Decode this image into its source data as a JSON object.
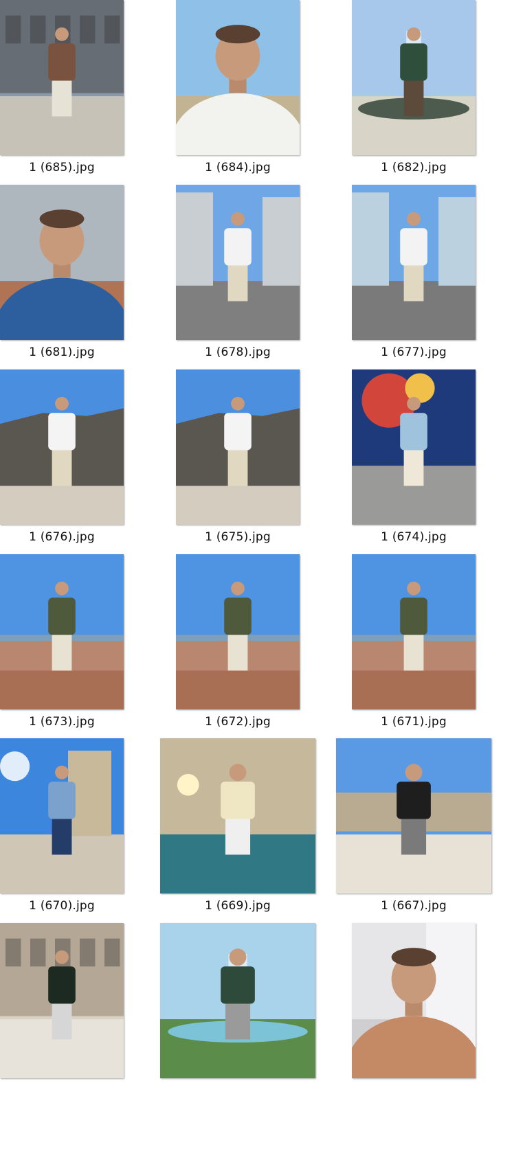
{
  "files": [
    {
      "name": "1 (685).jpg",
      "scene": "building",
      "colors": {
        "sky": "#8a97a8",
        "ground": "#c7c2b7",
        "fg": "#3b3a38",
        "shirt": "#7a5240",
        "pants": "#e7e2d6"
      }
    },
    {
      "name": "1 (684).jpg",
      "scene": "selfie",
      "colors": {
        "sky": "#8fc1e8",
        "ground": "#c2b493",
        "fg": "#b89c80",
        "shirt": "#f2f2ef",
        "pants": "#f2f2ef"
      }
    },
    {
      "name": "1 (682).jpg",
      "scene": "fountain",
      "colors": {
        "sky": "#a7c8ea",
        "ground": "#d9d4c8",
        "fg": "#4d5b4f",
        "shirt": "#2f4f3c",
        "pants": "#5c4b3a"
      }
    },
    {
      "name": "1 (681).jpg",
      "scene": "selfie",
      "colors": {
        "sky": "#aeb6be",
        "ground": "#b07454",
        "fg": "#b97b5c",
        "shirt": "#2d5f9e",
        "pants": "#2d5f9e"
      }
    },
    {
      "name": "1 (678).jpg",
      "scene": "street",
      "colors": {
        "sky": "#6fa7e6",
        "ground": "#7f7f7f",
        "fg": "#c9ced2",
        "shirt": "#f3f3f3",
        "pants": "#e1d8c2"
      }
    },
    {
      "name": "1 (677).jpg",
      "scene": "street",
      "colors": {
        "sky": "#6ea7e6",
        "ground": "#7a7a7a",
        "fg": "#bcd1e0",
        "shirt": "#f3f3f3",
        "pants": "#e1d8c2"
      }
    },
    {
      "name": "1 (676).jpg",
      "scene": "cliff",
      "colors": {
        "sky": "#4a8ee0",
        "ground": "#d4cdbf",
        "fg": "#5a5650",
        "shirt": "#f4f4f4",
        "pants": "#e1d8c2"
      }
    },
    {
      "name": "1 (675).jpg",
      "scene": "cliff",
      "colors": {
        "sky": "#4d8fdf",
        "ground": "#d4cdbf",
        "fg": "#5a5650",
        "shirt": "#f4f4f4",
        "pants": "#e1d8c2"
      }
    },
    {
      "name": "1 (674).jpg",
      "scene": "mural",
      "colors": {
        "sky": "#1e3a7a",
        "ground": "#9a9a98",
        "fg": "#d1453b",
        "shirt": "#9fc3dc",
        "pants": "#efe8d8"
      }
    },
    {
      "name": "1 (673).jpg",
      "scene": "viewpoint",
      "colors": {
        "sky": "#4f93e3",
        "ground": "#a96f55",
        "fg": "#c99f88",
        "shirt": "#4f5a3c",
        "pants": "#e8e2d2"
      }
    },
    {
      "name": "1 (672).jpg",
      "scene": "viewpoint",
      "colors": {
        "sky": "#4f93e3",
        "ground": "#a96f55",
        "fg": "#c99f88",
        "shirt": "#4f5a3c",
        "pants": "#e8e2d2"
      }
    },
    {
      "name": "1 (671).jpg",
      "scene": "viewpoint",
      "colors": {
        "sky": "#4f93e3",
        "ground": "#a96f55",
        "fg": "#c99f88",
        "shirt": "#4f5a3c",
        "pants": "#e8e2d2"
      }
    },
    {
      "name": "1 (670).jpg",
      "scene": "tower",
      "colors": {
        "sky": "#3d86dd",
        "ground": "#cfc6b5",
        "fg": "#c8b99a",
        "shirt": "#7aa2cc",
        "pants": "#233c68"
      }
    },
    {
      "name": "1 (669).jpg",
      "scene": "sunset",
      "colors": {
        "sky": "#c6b89a",
        "ground": "#3a6e78",
        "fg": "#6a6a5a",
        "shirt": "#efe6c4",
        "pants": "#efefef"
      }
    },
    {
      "name": "1 (667).jpg",
      "scene": "terrace",
      "colors": {
        "sky": "#5a9ae4",
        "ground": "#e8e1d6",
        "fg": "#b9aa92",
        "shirt": "#1e1e1e",
        "pants": "#7a7a7a"
      }
    },
    {
      "name": "",
      "scene": "palace",
      "colors": {
        "sky": "#d8d2c4",
        "ground": "#e7e3da",
        "fg": "#8a7460",
        "shirt": "#1c2a22",
        "pants": "#d6d6d6"
      }
    },
    {
      "name": "",
      "scene": "fountain2",
      "colors": {
        "sky": "#a8d3ea",
        "ground": "#5b8c4a",
        "fg": "#7cc3d8",
        "shirt": "#2e4a3a",
        "pants": "#9a9a9a"
      }
    },
    {
      "name": "",
      "scene": "mirror",
      "colors": {
        "sky": "#e6e6e8",
        "ground": "#cfcfd2",
        "fg": "#c48a66",
        "shirt": "#c48a66",
        "pants": "#9d9d9d"
      }
    }
  ]
}
